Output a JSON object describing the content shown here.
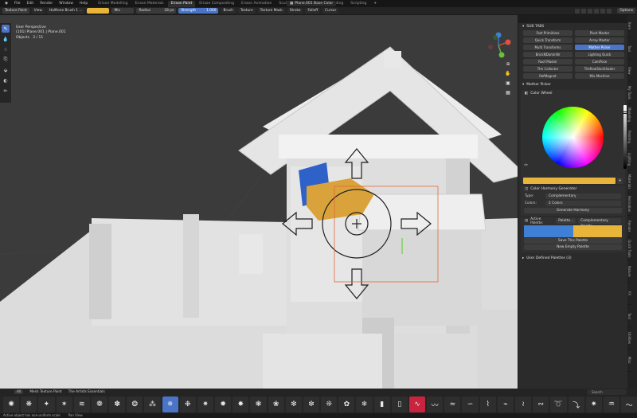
{
  "menu": [
    "File",
    "Edit",
    "Render",
    "Window",
    "Help"
  ],
  "workspace_tabs": [
    {
      "label": "Erixon Modelling",
      "active": false
    },
    {
      "label": "Erixon Materials",
      "active": false
    },
    {
      "label": "Erixon Paint",
      "active": true
    },
    {
      "label": "Erixon Compositing",
      "active": false
    },
    {
      "label": "Erixon Animation",
      "active": false
    },
    {
      "label": "Sculpting",
      "active": false
    },
    {
      "label": "UV Editing",
      "active": false
    },
    {
      "label": "Shading",
      "active": false
    },
    {
      "label": "Scripting",
      "active": false
    }
  ],
  "add_tab": "+",
  "material_slot": "Plane.001 Base Color",
  "toolbar": {
    "mode": "Texture Paint",
    "view": "View",
    "brush_name": "Halftone Brush 1 ...",
    "blend": "Mix",
    "radius_label": "Radius",
    "radius_value": "28 px",
    "strength_label": "Strength",
    "strength_value": "1.000",
    "brush": "Brush",
    "texture": "Texture",
    "texture_mask": "Texture Mask",
    "stroke": "Stroke",
    "falloff": "Falloff",
    "cursor": "Cursor",
    "options": "Options",
    "accent": "#e8b43a"
  },
  "viewport": {
    "line1": "User Perspective",
    "line2": "(101) Plane.001 | Plane.001",
    "objects_label": "Objects",
    "objects_value": "2 / 11"
  },
  "subtabs": {
    "title": "SUB TABS",
    "items": [
      {
        "label": "Fast Primitives",
        "active": false
      },
      {
        "label": "Pivot Master",
        "active": false
      },
      {
        "label": "Quick Transform",
        "active": false
      },
      {
        "label": "Array Master",
        "active": false
      },
      {
        "label": "Multi Transforms",
        "active": false
      },
      {
        "label": "Mother Picker",
        "active": true
      },
      {
        "label": "BrickNDominNr",
        "active": false
      },
      {
        "label": "Lighting Quick",
        "active": false
      },
      {
        "label": "Roof Master",
        "active": false
      },
      {
        "label": "CamPose",
        "active": false
      },
      {
        "label": "TIm Collector",
        "active": false
      },
      {
        "label": "TileRealSlonShader",
        "active": false
      },
      {
        "label": "RefMagnet",
        "active": false
      },
      {
        "label": "Mix Machine",
        "active": false
      }
    ]
  },
  "mother_picker": {
    "title": "Mother Picker",
    "color_wheel": "Color Wheel",
    "current_color": "#e8b43a",
    "harmony_title": "Color Harmony Generator",
    "type_label": "Type:",
    "type_value": "Complementary",
    "colors_label": "Colors:",
    "colors_value": "2 Colors",
    "generate_btn": "Generate Harmony",
    "active_palette_label": "Active Palette:",
    "palette_dd": "Palette...",
    "palette_name": "Complementary Palette",
    "palette_colors": [
      "#3f7fd6",
      "#e8b43a"
    ],
    "save_btn": "Save This Palette",
    "new_btn": "New Empty Palette",
    "user_palettes": "User Defined Palettes (3)"
  },
  "side_tabs": [
    "Item",
    "Tool",
    "View",
    "My Tools",
    "Modeling",
    "Painting",
    "Lighting",
    "Materials",
    "Animation",
    "Render",
    "Quick Tools",
    "Nature",
    "FX",
    "Tool",
    "Utilities",
    "Misc"
  ],
  "asset_bar": {
    "all": "All",
    "items": [
      "Mesh Texture Paint",
      "The Artists Essentials"
    ],
    "search_placeholder": "Search"
  },
  "status": {
    "left": "Active object has non-uniform scale",
    "right": "Pan View"
  },
  "brush_glyphs": [
    "✺",
    "❋",
    "✦",
    "✶",
    "≋",
    "❁",
    "✽",
    "❂",
    "⁂",
    "✵",
    "❉",
    "✷",
    "✹",
    "✸",
    "❃",
    "❀",
    "✻",
    "✼",
    "❊",
    "✿",
    "❄",
    "▮",
    "▯",
    "∿",
    "〰",
    "≈",
    "∽",
    "⌇",
    "⌁",
    "≀",
    "∾",
    "➰",
    "⤵",
    "✷",
    "♒",
    "〜"
  ]
}
